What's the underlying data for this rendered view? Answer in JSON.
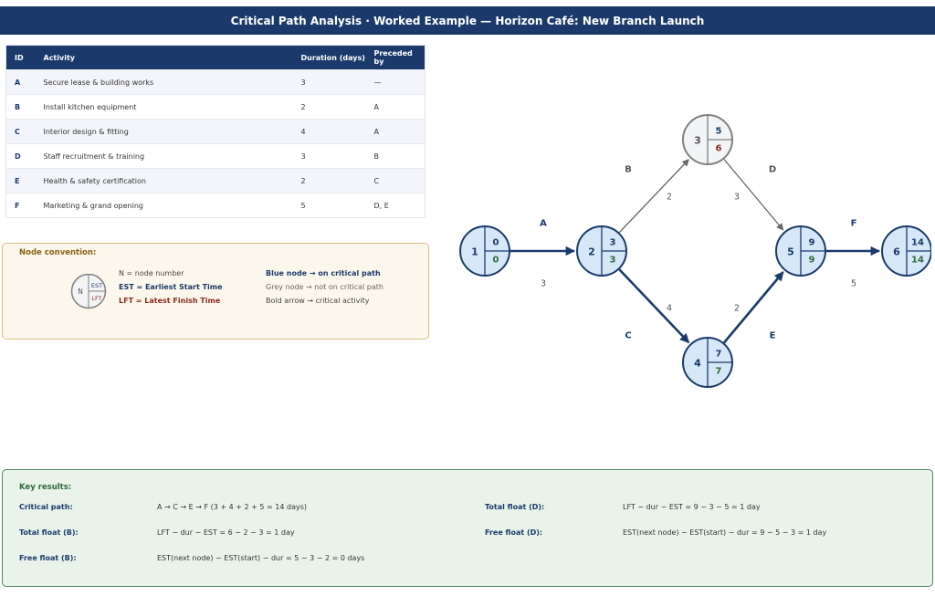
{
  "title": "Critical Path Analysis  ·  Worked Example  —  Horizon Café: New Branch Launch",
  "table": {
    "headers": [
      "ID",
      "Activity",
      "Duration (days)",
      "Preceded by"
    ],
    "rows": [
      {
        "id": "A",
        "activity": "Secure lease & building works",
        "duration": "3",
        "preceded": "—"
      },
      {
        "id": "B",
        "activity": "Install kitchen equipment",
        "duration": "2",
        "preceded": "A"
      },
      {
        "id": "C",
        "activity": "Interior design & fitting",
        "duration": "4",
        "preceded": "A"
      },
      {
        "id": "D",
        "activity": "Staff recruitment & training",
        "duration": "3",
        "preceded": "B"
      },
      {
        "id": "E",
        "activity": "Health & safety certification",
        "duration": "2",
        "preceded": "C"
      },
      {
        "id": "F",
        "activity": "Marketing & grand opening",
        "duration": "5",
        "preceded": "D, E"
      }
    ]
  },
  "convention": {
    "title": "Node convention:",
    "icon": {
      "n": "N",
      "est": "EST",
      "lft": "LFT"
    },
    "lines": {
      "n": "N  =  node number",
      "est": "EST  =  Earliest Start Time",
      "lft": "LFT  =  Latest Finish Time",
      "blue": "Blue node  →  on critical path",
      "grey": "Grey node  →  not on critical path",
      "bold": "Bold arrow  →  critical activity"
    }
  },
  "network": {
    "nodes": [
      {
        "n": "1",
        "est": "0",
        "lft": "0",
        "critical": true
      },
      {
        "n": "2",
        "est": "3",
        "lft": "3",
        "critical": true
      },
      {
        "n": "3",
        "est": "5",
        "lft": "6",
        "critical": false
      },
      {
        "n": "4",
        "est": "7",
        "lft": "7",
        "critical": true
      },
      {
        "n": "5",
        "est": "9",
        "lft": "9",
        "critical": true
      },
      {
        "n": "6",
        "est": "14",
        "lft": "14",
        "critical": true
      }
    ],
    "edges": [
      {
        "activity": "A",
        "duration": "3",
        "from": "1",
        "to": "2",
        "critical": true
      },
      {
        "activity": "B",
        "duration": "2",
        "from": "2",
        "to": "3",
        "critical": false
      },
      {
        "activity": "C",
        "duration": "4",
        "from": "2",
        "to": "4",
        "critical": true
      },
      {
        "activity": "D",
        "duration": "3",
        "from": "3",
        "to": "5",
        "critical": false
      },
      {
        "activity": "E",
        "duration": "2",
        "from": "4",
        "to": "5",
        "critical": true
      },
      {
        "activity": "F",
        "duration": "5",
        "from": "5",
        "to": "6",
        "critical": true
      }
    ]
  },
  "results": {
    "title": "Key results:",
    "items": [
      {
        "label": "Critical path:",
        "value": "A  →  C  →  E  →  F     (3 + 4 + 2 + 5 = 14 days)"
      },
      {
        "label": "Total float (B):",
        "value": "LFT − dur − EST  =  6 − 2 − 3  =  1 day"
      },
      {
        "label": "Free float (B):",
        "value": "EST(next node) − EST(start) − dur  =  5 − 3 − 2  =  0 days"
      },
      {
        "label": "Total float (D):",
        "value": "LFT − dur − EST  =  9 − 3 − 5  =  1 day"
      },
      {
        "label": "Free float (D):",
        "value": "EST(next node) − EST(start) − dur  =  9 − 5 − 3  =  1 day"
      }
    ]
  },
  "colors": {
    "navy": "#1b3a6b",
    "critical_fill": "#d6e7f7",
    "noncritical_fill": "#f3f4f6",
    "noncritical_stroke": "#808080",
    "green": "#2e6b3a",
    "red": "#8b2a22"
  }
}
